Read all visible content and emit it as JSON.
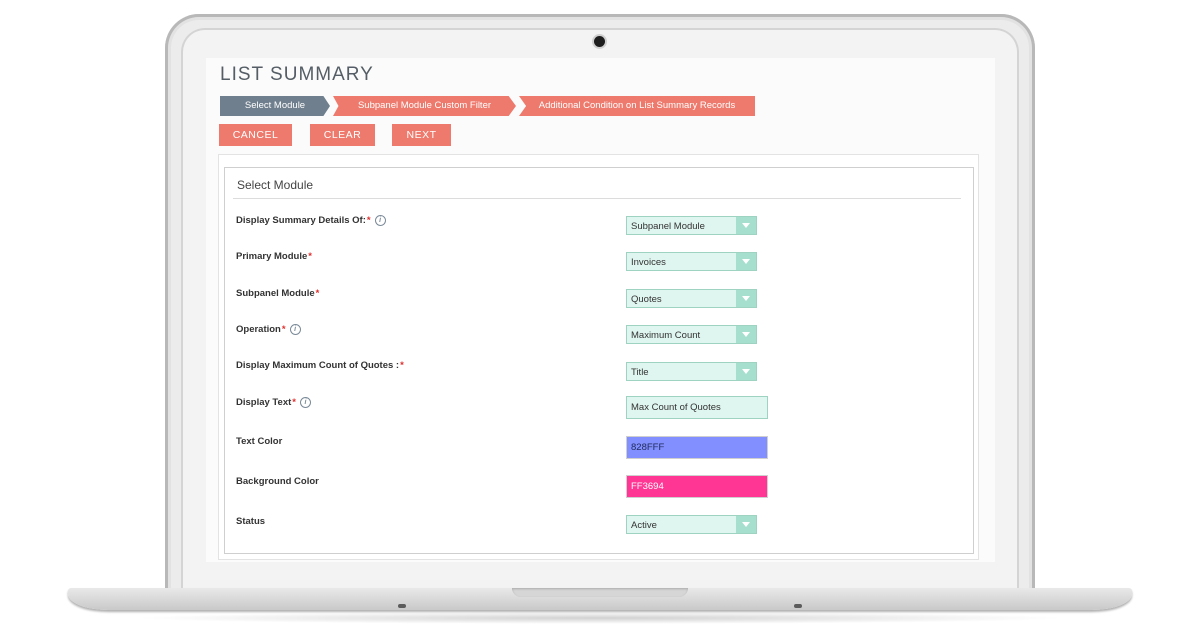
{
  "page": {
    "title": "LIST SUMMARY"
  },
  "steps": [
    {
      "label": "Select Module",
      "state": "active"
    },
    {
      "label": "Subpanel Module Custom Filter",
      "state": "pending"
    },
    {
      "label": "Additional Condition on List Summary Records",
      "state": "pending"
    }
  ],
  "actions": {
    "cancel": "CANCEL",
    "clear": "CLEAR",
    "next": "NEXT"
  },
  "section": {
    "title": "Select Module"
  },
  "fields": {
    "display_summary": {
      "label": "Display Summary Details Of:",
      "required": "*",
      "value": "Subpanel Module"
    },
    "primary_module": {
      "label": "Primary Module",
      "required": "*",
      "value": "Invoices"
    },
    "subpanel_module": {
      "label": "Subpanel Module",
      "required": "*",
      "value": "Quotes"
    },
    "operation": {
      "label": "Operation",
      "required": "*",
      "value": "Maximum Count"
    },
    "display_max_count": {
      "label": "Display Maximum Count of Quotes :",
      "required": "*",
      "value": "Title"
    },
    "display_text": {
      "label": "Display Text",
      "required": "*",
      "value": "Max Count of Quotes"
    },
    "text_color": {
      "label": "Text Color",
      "value": "828FFF"
    },
    "background_color": {
      "label": "Background Color",
      "value": "FF3694"
    },
    "status": {
      "label": "Status",
      "value": "Active"
    }
  },
  "colors": {
    "accent": "#ee7a6d",
    "active_step": "#6f7f8d",
    "field_bg": "#dff5ef",
    "text_color_swatch": "#828FFF",
    "background_color_swatch": "#FF3694",
    "required_mark": "#e0312f"
  },
  "icons": {
    "info": "info-circle-icon",
    "dropdown": "caret-down-icon"
  }
}
